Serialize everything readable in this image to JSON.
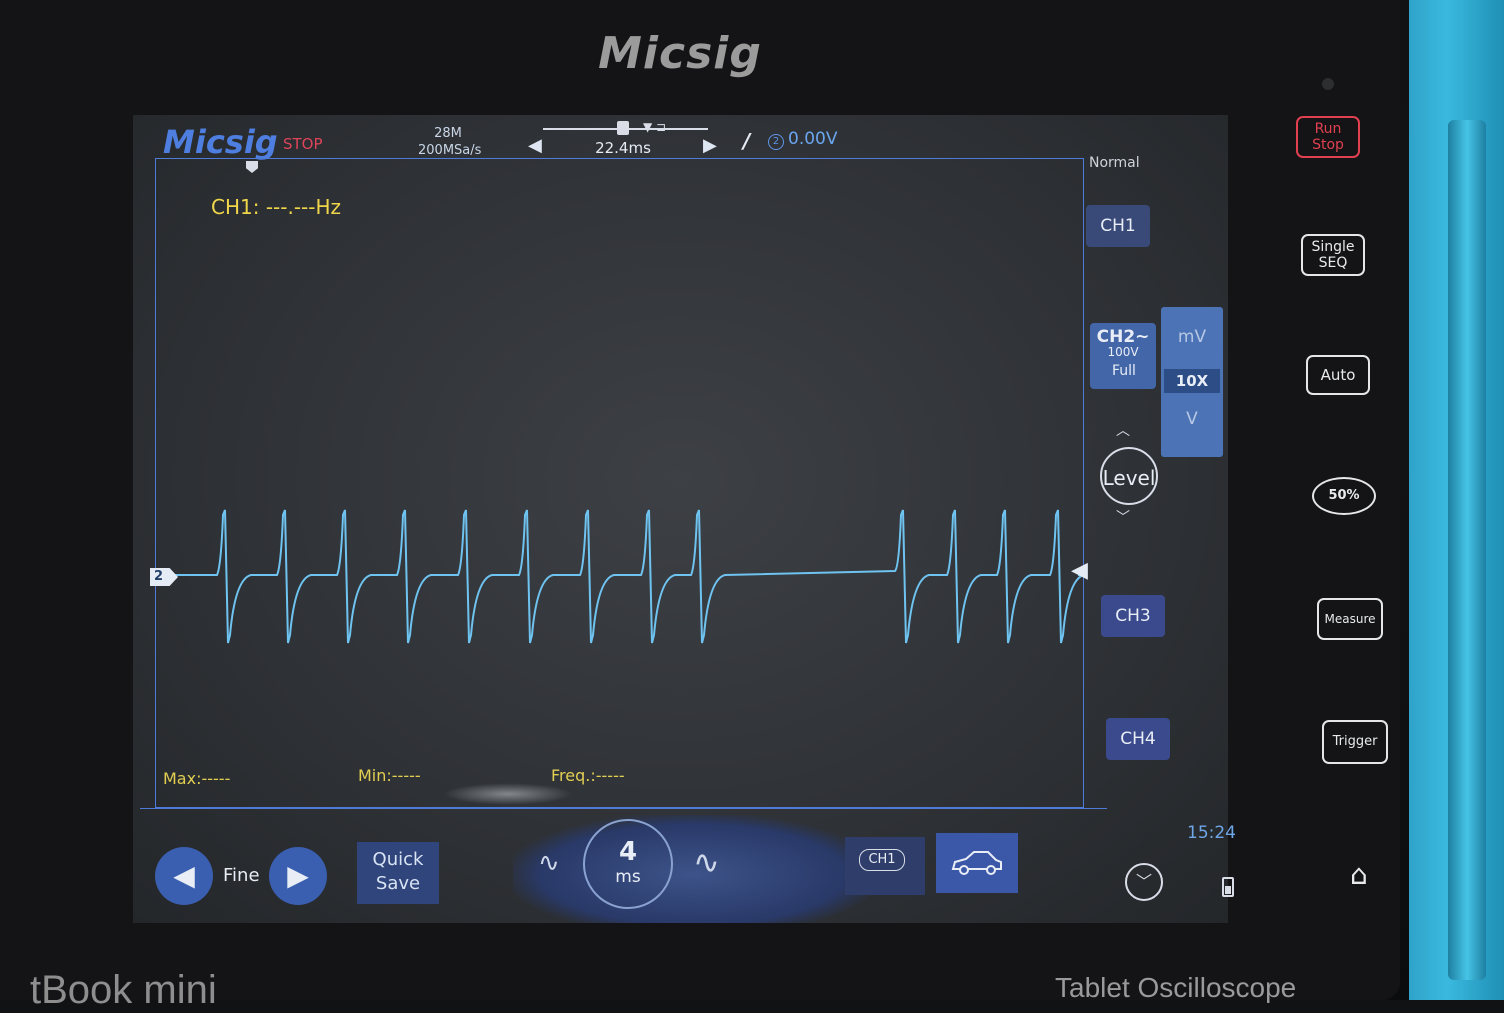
{
  "device": {
    "brand": "Micsig",
    "bottom_left_text": "tBook mini",
    "bottom_right_text": "Tablet Oscilloscope"
  },
  "status": {
    "logo": "Micsig",
    "run_state": "STOP",
    "memory_depth": "28M",
    "sample_rate": "200MSa/s",
    "time_offset": "22.4ms",
    "trigger_source": "2",
    "trigger_level": "0.00V",
    "trigger_mode": "Normal",
    "clock": "15:24"
  },
  "display": {
    "ch1_freq": "CH1: ---.---Hz",
    "ch2_marker": "2",
    "meas_max": "Max:-----",
    "meas_min": "Min:-----",
    "meas_freq": "Freq.:-----"
  },
  "channels": {
    "ch1": "CH1",
    "ch2": "CH2~",
    "ch2_vdiv": "100V",
    "ch2_bw": "Full",
    "unit_mv": "mV",
    "probe": "10X",
    "unit_v": "V",
    "level": "Level",
    "ch3": "CH3",
    "ch4": "CH4"
  },
  "bottom_bar": {
    "fine": "Fine",
    "quick_save_line1": "Quick",
    "quick_save_line2": "Save",
    "timebase_value": "4",
    "timebase_unit": "ms",
    "ch1_tab": "CH1"
  },
  "hardware": {
    "run_line1": "Run",
    "run_line2": "Stop",
    "single_line1": "Single",
    "single_line2": "SEQ",
    "auto": "Auto",
    "fifty": "50%",
    "measure": "Measure",
    "trigger": "Trigger"
  },
  "colors": {
    "trace": "#6fc3f0",
    "accent_blue": "#4e7bd8",
    "measure_yellow": "#e2cf52",
    "stop_red": "#e0445a"
  }
}
